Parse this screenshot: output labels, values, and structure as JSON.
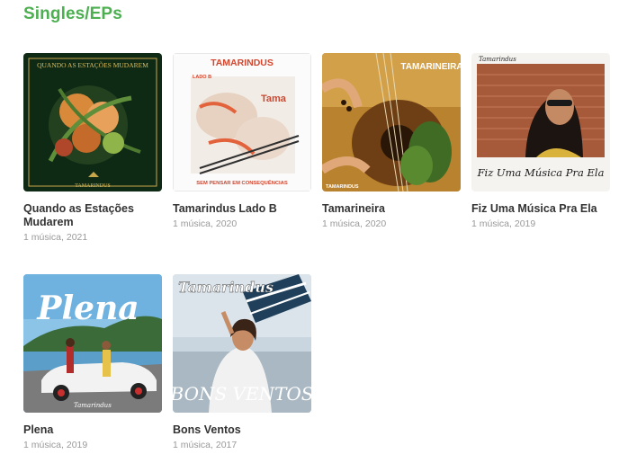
{
  "section": {
    "title": "Singles/EPs"
  },
  "albums": [
    {
      "cover_text": "QUANDO AS ESTAÇÕES MUDAREM",
      "cover_brand": "TAMARINDUS",
      "title": "Quando as Estações Mudarem",
      "tracks": "1 música",
      "year": "2021"
    },
    {
      "cover_text": "TAMARINDUS",
      "cover_subtext": "LADO B",
      "cover_footer": "SEM PENSAR EM CONSEQUÊNCIAS",
      "title": "Tamarindus Lado B",
      "tracks": "1 música",
      "year": "2020"
    },
    {
      "cover_text": "TAMARINEIRA",
      "cover_brand": "TAMARINDUS",
      "title": "Tamarineira",
      "tracks": "1 música",
      "year": "2020"
    },
    {
      "cover_brand": "Tamarindus",
      "cover_text": "Fiz Uma Música Pra Ela",
      "title": "Fiz Uma Música Pra Ela",
      "tracks": "1 música",
      "year": "2019"
    },
    {
      "cover_text": "Plena",
      "cover_brand": "Tamarindus",
      "title": "Plena",
      "tracks": "1 música",
      "year": "2019"
    },
    {
      "cover_brand": "Tamarindus",
      "cover_text": "BONS VENTOS",
      "title": "Bons Ventos",
      "tracks": "1 música",
      "year": "2017"
    }
  ],
  "colors": {
    "accent": "#4caf50",
    "title_text": "#333333",
    "meta_text": "#999999"
  }
}
